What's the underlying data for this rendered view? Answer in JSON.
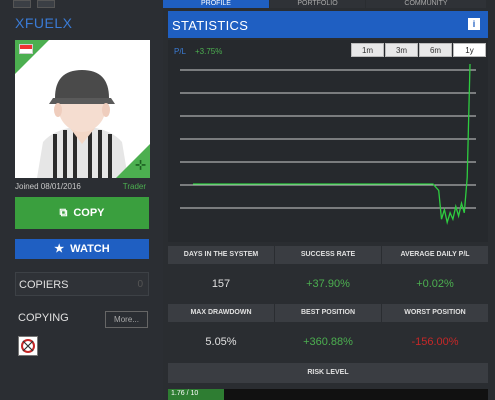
{
  "profile": {
    "username": "XFUELX",
    "joined": "Joined 08/01/2016",
    "role": "Trader",
    "copy_label": "COPY",
    "watch_label": "WATCH",
    "copiers_label": "COPIERS",
    "copiers_count": "0",
    "copying_label": "COPYING",
    "more_label": "More..."
  },
  "tabs": [
    {
      "label": "PROFILE",
      "active": true
    },
    {
      "label": "PORTFOLIO",
      "active": false
    },
    {
      "label": "COMMUNITY",
      "active": false
    }
  ],
  "statistics": {
    "title": "STATISTICS",
    "pl_label": "P/L",
    "pl_value": "+3.75%",
    "ranges": [
      {
        "label": "1m",
        "active": false
      },
      {
        "label": "3m",
        "active": false
      },
      {
        "label": "6m",
        "active": false
      },
      {
        "label": "1y",
        "active": true
      }
    ]
  },
  "chart_data": {
    "type": "line",
    "series": [
      {
        "values": [
          0,
          0,
          0,
          0,
          0,
          0,
          0,
          0,
          0,
          0,
          0,
          0,
          0,
          0,
          0,
          -0.1,
          -0.2,
          -1.1,
          -0.8,
          -1.2,
          -0.9,
          -1.1,
          -0.7,
          -1.0,
          -0.6,
          -0.9,
          0.2,
          3.75
        ]
      }
    ],
    "grid": true,
    "color": "#2ecc40"
  },
  "stats": [
    {
      "label": "DAYS IN THE SYSTEM",
      "value": "157",
      "color": "#e0e0e0"
    },
    {
      "label": "SUCCESS RATE",
      "value": "+37.90%",
      "color": "#4caf50"
    },
    {
      "label": "AVERAGE DAILY P/L",
      "value": "+0.02%",
      "color": "#4caf50"
    },
    {
      "label": "MAX DRAWDOWN",
      "value": "5.05%",
      "color": "#e0e0e0"
    },
    {
      "label": "BEST POSITION",
      "value": "+360.88%",
      "color": "#4caf50"
    },
    {
      "label": "WORST POSITION",
      "value": "-156.00%",
      "color": "#c62828"
    }
  ],
  "risk": {
    "label": "RISK LEVEL",
    "value_text": "1.76 / 10",
    "fraction": 0.176
  },
  "colors": {
    "accent_blue": "#1f5fc2",
    "accent_green": "#3a9f3e",
    "negative_red": "#c62828"
  }
}
